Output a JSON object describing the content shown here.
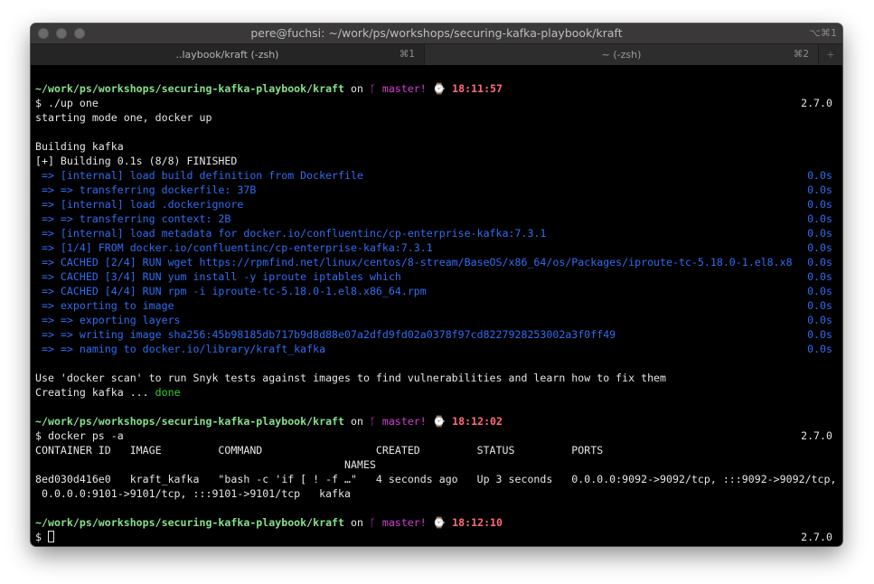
{
  "window": {
    "title": "pere@fuchsi: ~/work/ps/workshops/securing-kafka-playbook/kraft",
    "shortcut": "⌥⌘1"
  },
  "tabs": [
    {
      "label": "..laybook/kraft (-zsh)",
      "shortcut": "⌘1"
    },
    {
      "label": "~ (-zsh)",
      "shortcut": "⌘2"
    }
  ],
  "new_tab_label": "+",
  "prompt": {
    "path": "~/work/ps/workshops/securing-kafka-playbook/kraft",
    "on": " on ",
    "branch_icon": "ᚴ",
    "branch": " master!",
    "clock_icon": "⌚",
    "version": "2.7.0"
  },
  "block1": {
    "time": "18:11:57",
    "command": "$ ./up one",
    "out1": "starting mode one, docker up",
    "out2": "Building kafka",
    "out3": "[+] Building 0.1s (8/8) FINISHED",
    "steps": [
      {
        "text": " => [internal] load build definition from Dockerfile",
        "time": "0.0s"
      },
      {
        "text": " => => transferring dockerfile: 37B",
        "time": "0.0s"
      },
      {
        "text": " => [internal] load .dockerignore",
        "time": "0.0s"
      },
      {
        "text": " => => transferring context: 2B",
        "time": "0.0s"
      },
      {
        "text": " => [internal] load metadata for docker.io/confluentinc/cp-enterprise-kafka:7.3.1",
        "time": "0.0s"
      },
      {
        "text": " => [1/4] FROM docker.io/confluentinc/cp-enterprise-kafka:7.3.1",
        "time": "0.0s"
      },
      {
        "text": " => CACHED [2/4] RUN wget https://rpmfind.net/linux/centos/8-stream/BaseOS/x86_64/os/Packages/iproute-tc-5.18.0-1.el8.x8",
        "time": "0.0s"
      },
      {
        "text": " => CACHED [3/4] RUN yum install -y iproute iptables which",
        "time": "0.0s"
      },
      {
        "text": " => CACHED [4/4] RUN rpm -i iproute-tc-5.18.0-1.el8.x86_64.rpm",
        "time": "0.0s"
      },
      {
        "text": " => exporting to image",
        "time": "0.0s"
      },
      {
        "text": " => => exporting layers",
        "time": "0.0s"
      },
      {
        "text": " => => writing image sha256:45b98185db717b9d8d88e07a2dfd9fd02a0378f97cd8227928253002a3f0ff49",
        "time": "0.0s"
      },
      {
        "text": " => => naming to docker.io/library/kraft_kafka",
        "time": "0.0s"
      }
    ],
    "scan_msg": "Use 'docker scan' to run Snyk tests against images to find vulnerabilities and learn how to fix them",
    "creating": "Creating kafka ... ",
    "done": "done"
  },
  "block2": {
    "time": "18:12:02",
    "command": "$ docker ps -a",
    "header": "CONTAINER ID   IMAGE         COMMAND                  CREATED         STATUS         PORTS",
    "header2": "                                                 NAMES",
    "row1": "8ed030d416e0   kraft_kafka   \"bash -c 'if [ ! -f …\"   4 seconds ago   Up 3 seconds   0.0.0.0:9092->9092/tcp, :::9092->9092/tcp,",
    "row2": " 0.0.0.0:9101->9101/tcp, :::9101->9101/tcp   kafka"
  },
  "block3": {
    "time": "18:12:10",
    "command": "$ "
  },
  "colors": {
    "path": "#86e08a",
    "branch": "#d33bd3",
    "time": "#ff6b77",
    "build_step": "#2f6df0",
    "done": "#2ed12e",
    "background": "#000000"
  }
}
